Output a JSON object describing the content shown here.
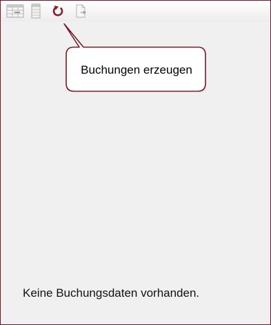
{
  "toolbar": {
    "buttons": [
      {
        "icon": "table-view-icon"
      },
      {
        "icon": "column-view-icon"
      },
      {
        "icon": "refresh-icon",
        "color": "#8b1a2b"
      },
      {
        "icon": "document-export-icon"
      }
    ]
  },
  "callout": {
    "text": "Buchungen erzeugen",
    "border_color": "#7a1626"
  },
  "main": {
    "empty_message": "Keine Buchungsdaten vorhanden."
  },
  "colors": {
    "frame": "#6e1523",
    "background": "#f0f0f0",
    "accent": "#8b1a2b"
  }
}
